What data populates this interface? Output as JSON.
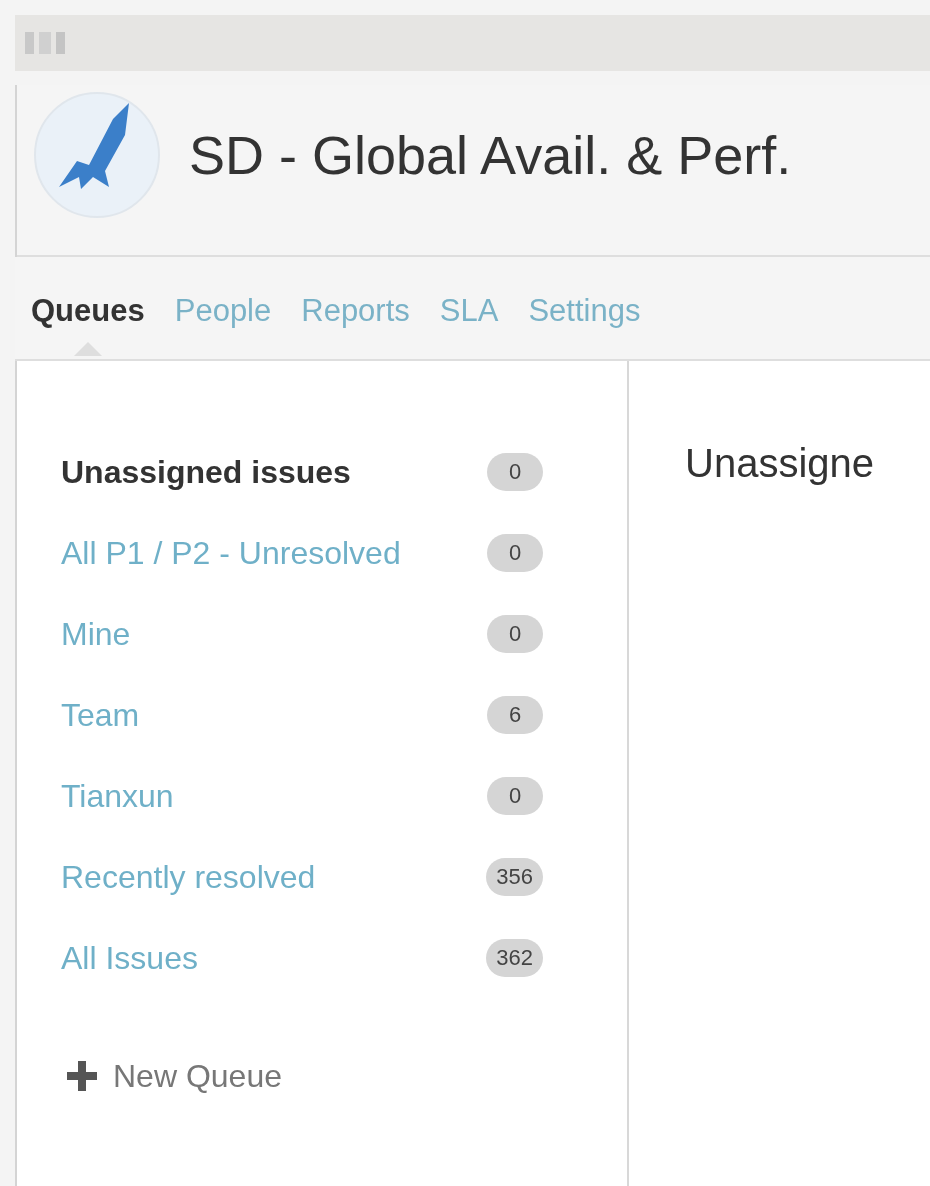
{
  "project": {
    "title": "SD - Global Avail. & Perf."
  },
  "tabs": [
    {
      "label": "Queues",
      "selected": true
    },
    {
      "label": "People",
      "selected": false
    },
    {
      "label": "Reports",
      "selected": false
    },
    {
      "label": "SLA",
      "selected": false
    },
    {
      "label": "Settings",
      "selected": false
    }
  ],
  "queues": [
    {
      "label": "Unassigned issues",
      "count": "0",
      "selected": true
    },
    {
      "label": "All P1 / P2 - Unresolved",
      "count": "0",
      "selected": false
    },
    {
      "label": "Mine",
      "count": "0",
      "selected": false
    },
    {
      "label": "Team",
      "count": "6",
      "selected": false
    },
    {
      "label": "Tianxun",
      "count": "0",
      "selected": false
    },
    {
      "label": "Recently resolved",
      "count": "356",
      "selected": false
    },
    {
      "label": "All Issues",
      "count": "362",
      "selected": false
    }
  ],
  "new_queue": {
    "label": "New Queue"
  },
  "main": {
    "heading": "Unassigne"
  }
}
